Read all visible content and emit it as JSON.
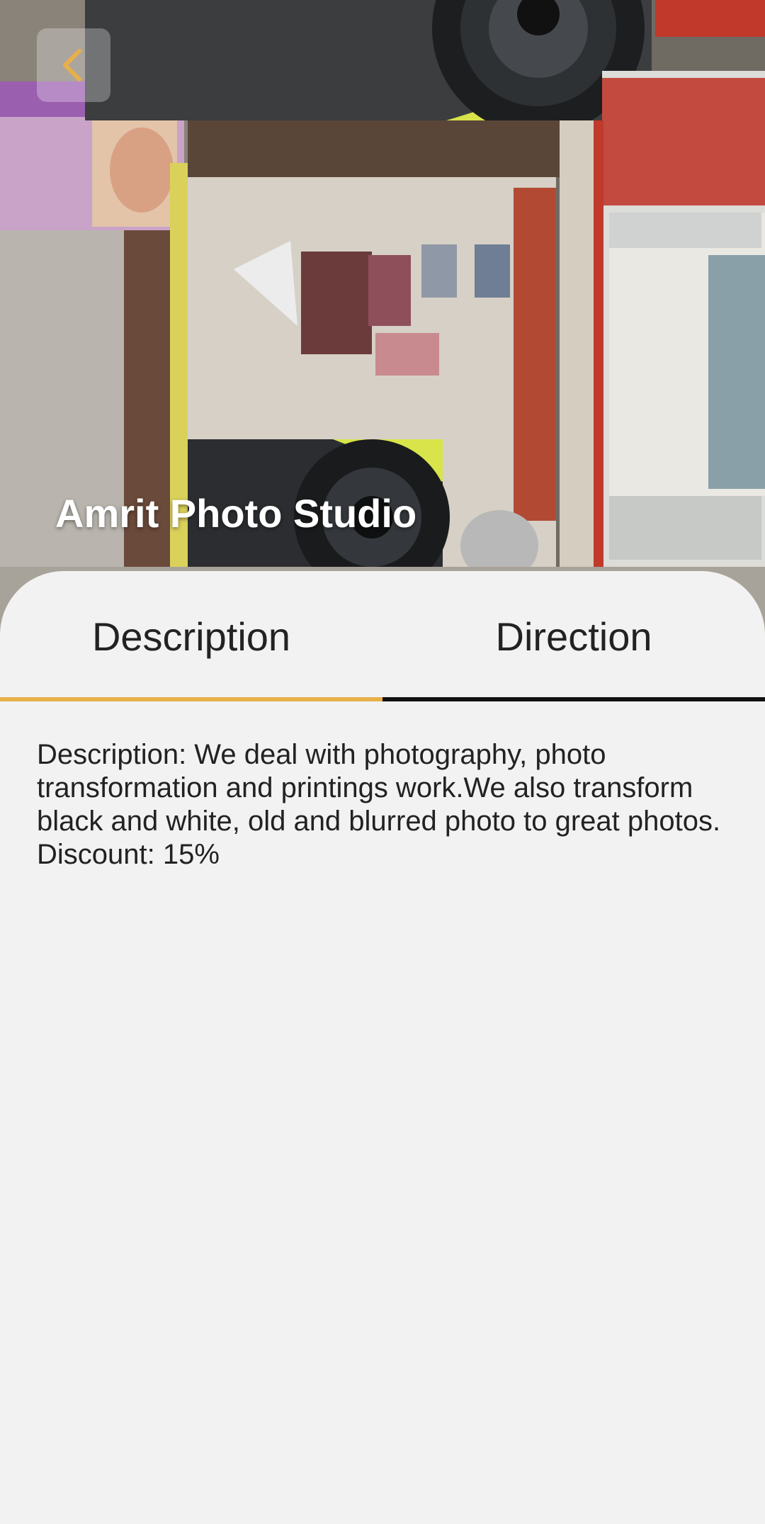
{
  "header": {
    "title": "Amrit Photo Studio",
    "back_icon": "chevron-left-icon",
    "photo": "storefront-photo",
    "accent_color": "#e8b04a"
  },
  "tabs": [
    {
      "label": "Description",
      "selected": true
    },
    {
      "label": "Direction",
      "selected": false
    }
  ],
  "description": {
    "text": "Description: We deal with photography, photo transformation and printings work.We also transform black and white, old and blurred photo to great photos.    Discount: 15%"
  }
}
